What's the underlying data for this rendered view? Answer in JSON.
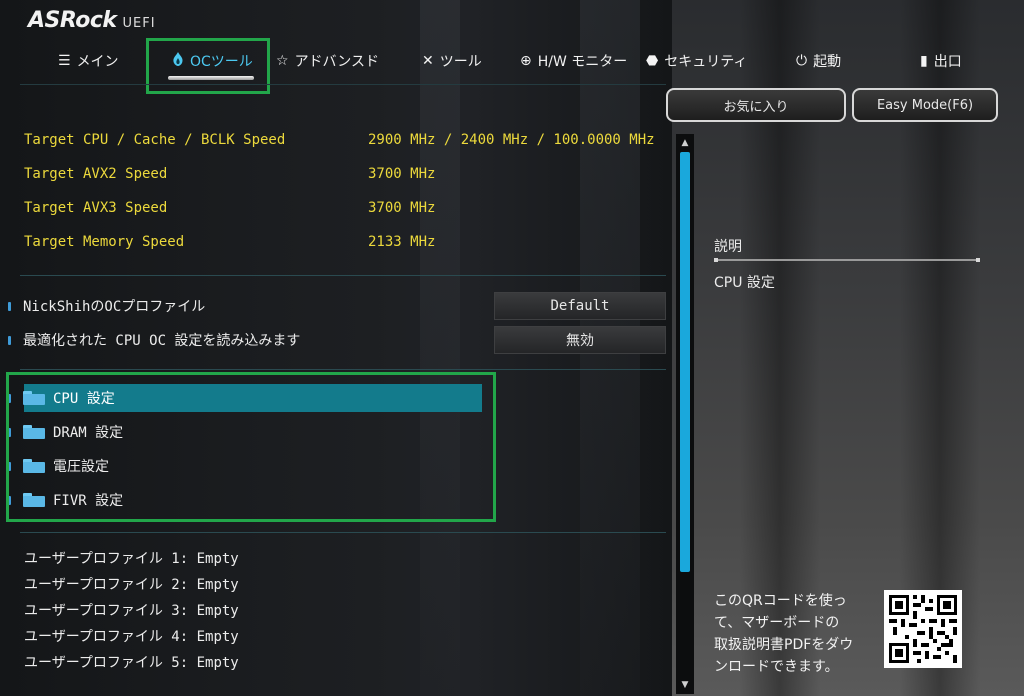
{
  "brand": {
    "name": "ASRock",
    "suffix": "UEFI"
  },
  "tabs": [
    {
      "icon": "list-icon",
      "glyph": "☰",
      "label": "メイン"
    },
    {
      "icon": "flame-icon",
      "glyph": "🔥",
      "label": "OCツール",
      "active": true
    },
    {
      "icon": "star-icon",
      "glyph": "☆",
      "label": "アドバンスド"
    },
    {
      "icon": "tools-icon",
      "glyph": "✕",
      "label": "ツール"
    },
    {
      "icon": "crosshair-icon",
      "glyph": "⊕",
      "label": "H/W モニター"
    },
    {
      "icon": "shield-icon",
      "glyph": "⬣",
      "label": "セキュリティ"
    },
    {
      "icon": "power-icon",
      "glyph": "⏻",
      "label": "起動"
    },
    {
      "icon": "exit-icon",
      "glyph": "▮",
      "label": "出口"
    }
  ],
  "buttons": {
    "favorites": "お気に入り",
    "easy_mode": "Easy Mode(F6)"
  },
  "targets": [
    {
      "label": "Target CPU / Cache / BCLK Speed",
      "value": "2900 MHz / 2400 MHz / 100.0000 MHz"
    },
    {
      "label": "Target AVX2 Speed",
      "value": "3700 MHz"
    },
    {
      "label": "Target AVX3 Speed",
      "value": "3700 MHz"
    },
    {
      "label": "Target Memory Speed",
      "value": "2133 MHz"
    }
  ],
  "options": [
    {
      "label": "NickShihのOCプロファイル",
      "value": "Default"
    },
    {
      "label": "最適化された CPU OC 設定を読み込みます",
      "value": "無効"
    }
  ],
  "submenus": [
    {
      "label": "CPU 設定",
      "selected": true
    },
    {
      "label": "DRAM 設定"
    },
    {
      "label": "電圧設定"
    },
    {
      "label": "FIVR 設定"
    }
  ],
  "profiles": [
    "ユーザープロファイル 1: Empty",
    "ユーザープロファイル 2: Empty",
    "ユーザープロファイル 3: Empty",
    "ユーザープロファイル 4: Empty",
    "ユーザープロファイル 5: Empty"
  ],
  "description": {
    "title": "説明",
    "text": "CPU 設定"
  },
  "qr": {
    "text_lines": [
      "このQRコードを使っ",
      "て、マザーボードの",
      "取扱説明書PDFをダウ",
      "ンロードできます。"
    ]
  },
  "colors": {
    "accent": "#1aa8dc",
    "highlight_row": "#137b8c",
    "info_text": "#ecd93c",
    "annotation_box": "#22a64a"
  }
}
